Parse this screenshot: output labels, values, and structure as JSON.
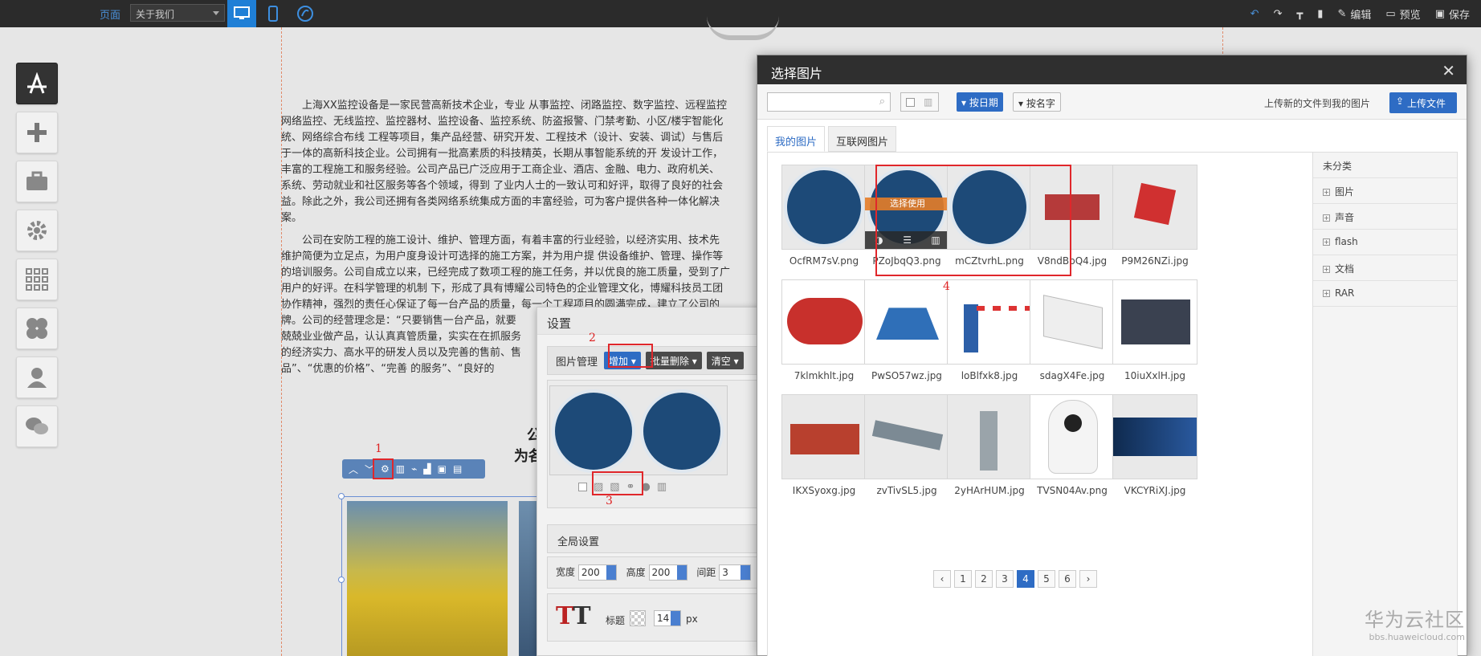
{
  "topbar": {
    "page_label": "页面",
    "page_select_value": "关于我们",
    "actions": {
      "edit": "编辑",
      "preview": "预览",
      "save": "保存"
    }
  },
  "content": {
    "para1": [
      "上海XX监控设备是一家民营高新技术企业，专业 从事监控、闭路监控、数字监控、远程监控",
      "网络监控、无线监控、监控器材、监控设备、监控系统、防盗报警、门禁考勤、小区/楼宇智能化",
      "统、网络综合布线 工程等项目，集产品经营、研究开发、工程技术（设计、安装、调试）与售后",
      "于一体的高新科技企业。公司拥有一批高素质的科技精英，长期从事智能系统的开 发设计工作，",
      "丰富的工程施工和服务经验。公司产品已广泛应用于工商企业、酒店、金融、电力、政府机关、",
      "系统、劳动就业和社区服务等各个领域，得到 了业内人士的一致认可和好评，取得了良好的社会",
      "益。除此之外，我公司还拥有各类网络系统集成方面的丰富经验，可为客户提供各种一体化解决",
      "案。"
    ],
    "para2": [
      "公司在安防工程的施工设计、维护、管理方面，有着丰富的行业经验，以经济实用、技术先",
      "维护简便为立足点，为用户度身设计可选择的施工方案，并为用户提 供设备维护、管理、操作等",
      "的培训服务。公司自成立以来，已经完成了数项工程的施工任务，并以优良的施工质量，受到了广",
      "用户的好评。在科学管理的机制 下，形成了具有博耀公司特色的企业管理文化，博耀科技员工团",
      "协作精神，强烈的责任心保证了每一台产品的质量，每一个工程项目的圆满完成，建立了公司的",
      "牌。公司的经营理念是：“只要销售一台产品，就要",
      "兢兢业业做产品，认认真真管质量，实实在在抓服务",
      "的经济实力、高水平的研发人员以及完善的售前、售",
      "品”、“优惠的价格”、“完善 的服务”、“良好的"
    ],
    "heading_line1": "公",
    "heading_line2": "为各"
  },
  "markers": {
    "m1": "1",
    "m2": "2",
    "m3": "3",
    "m4": "4"
  },
  "settings": {
    "title": "设置",
    "image_mgmt": "图片管理",
    "add_btn": "增加",
    "batch_delete_btn": "批量删除",
    "clear_btn": "清空",
    "global_settings": "全局设置",
    "width_label": "宽度",
    "width_value": "200",
    "height_label": "高度",
    "height_value": "200",
    "spacing_label": "间距",
    "spacing_value": "3",
    "caption_label": "标题",
    "font_size_value": "14",
    "font_unit": "px"
  },
  "picker": {
    "title": "选择图片",
    "sort_by_date": "按日期",
    "sort_by_name": "按名字",
    "upload_hint": "上传新的文件到我的图片",
    "upload_btn": "上传文件",
    "tab_mine": "我的图片",
    "tab_web": "互联网图片",
    "use_label": "选择使用",
    "images": [
      {
        "name": "OcfRM7sV.png"
      },
      {
        "name": "PZoJbqQ3.png"
      },
      {
        "name": "mCZtvrhL.png"
      },
      {
        "name": "V8ndBpQ4.jpg"
      },
      {
        "name": "P9M26NZi.jpg"
      },
      {
        "name": "7klmkhlt.jpg"
      },
      {
        "name": "PwSO57wz.jpg"
      },
      {
        "name": "loBlfxk8.jpg"
      },
      {
        "name": "sdagX4Fe.jpg"
      },
      {
        "name": "10iuXxlH.jpg"
      },
      {
        "name": "IKXSyoxg.jpg"
      },
      {
        "name": "zvTivSL5.jpg"
      },
      {
        "name": "2yHArHUM.jpg"
      },
      {
        "name": "TVSN04Av.png"
      },
      {
        "name": "VKCYRiXJ.jpg"
      }
    ],
    "categories": [
      "未分类",
      "图片",
      "声音",
      "flash",
      "文档",
      "RAR"
    ],
    "pages": [
      "1",
      "2",
      "3",
      "4",
      "5",
      "6"
    ],
    "current_page": "4"
  },
  "watermark": {
    "big": "华为云社区",
    "small": "bbs.huaweicloud.com"
  },
  "colors": {
    "accent": "#2e6cc4",
    "highlight_box": "#e0272b",
    "topbar": "#2b2b2b"
  }
}
